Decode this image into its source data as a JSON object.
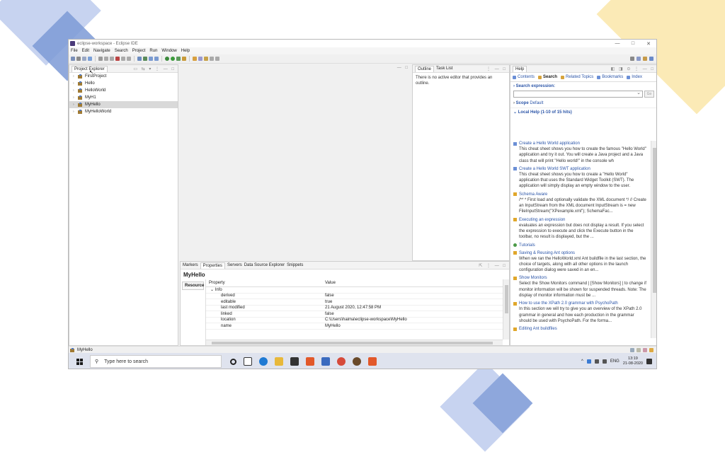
{
  "window": {
    "title": "eclipse-workspace - Eclipse IDE",
    "minimize": "—",
    "maximize": "□",
    "close": "✕"
  },
  "menu": [
    "File",
    "Edit",
    "Navigate",
    "Search",
    "Project",
    "Run",
    "Window",
    "Help"
  ],
  "explorer": {
    "tab": "Project Explorer",
    "projects": [
      {
        "name": "FirstProject",
        "selected": false
      },
      {
        "name": "Hello",
        "selected": false
      },
      {
        "name": "HelloWorld",
        "selected": false
      },
      {
        "name": "MyH1",
        "selected": false
      },
      {
        "name": "MyHello",
        "selected": true
      },
      {
        "name": "MyHelloWorld",
        "selected": false
      }
    ]
  },
  "outline": {
    "tabs": [
      "Outline",
      "Task List"
    ],
    "message": "There is no active editor that provides an outline."
  },
  "properties": {
    "tabs": [
      "Markers",
      "Properties",
      "Servers",
      "Data Source Explorer",
      "Snippets"
    ],
    "title": "MyHello",
    "side_tab": "Resource",
    "header": {
      "property": "Property",
      "value": "Value"
    },
    "group": "Info",
    "rows": [
      {
        "property": "derived",
        "value": "false"
      },
      {
        "property": "editable",
        "value": "true"
      },
      {
        "property": "last modified",
        "value": "21 August 2020, 12:47:58 PM"
      },
      {
        "property": "linked",
        "value": "false"
      },
      {
        "property": "location",
        "value": "C:\\Users\\haima\\eclipse-workspace\\MyHello"
      },
      {
        "property": "name",
        "value": "MyHello"
      }
    ]
  },
  "help": {
    "tab": "Help",
    "tabs": [
      "Contents",
      "Search",
      "Related Topics",
      "Bookmarks",
      "Index"
    ],
    "search_label": "Search expression:",
    "go": "Go",
    "scope_label": "Scope",
    "scope_value": "Default",
    "hits": "Local Help (1-10 of 15 hits)",
    "results": [
      {
        "title": "Create a Hello World application",
        "icon": "cheatsheet",
        "desc": "This cheat sheet shows you how to create the famous \"Hello World\" application and try it out. You will create a Java project and a Java class that will print \"Hello world!\" in the console wh"
      },
      {
        "title": "Create a Hello World SWT application",
        "icon": "cheatsheet",
        "desc": "This cheat sheet shows you how to create a \"Hello World\" application that uses the Standard Widget Toolkit (SWT). The application will simply display an empty window to the user."
      },
      {
        "title": "Schema Aware",
        "icon": "ant",
        "desc": "/** * First load and optionally validate the XML document */ // Create an InputStream from the XML document InputStream is = new FileInputStream(\"XPexample.xml\"); SchemaFac..."
      },
      {
        "title": "Executing an expression",
        "icon": "ant",
        "desc": "evaluates an expression but does not display a result. If you select the expression to execute and click the Execute button in the toolbar, no result is displayed, but the ..."
      },
      {
        "title": "Tutorials",
        "icon": "tutorial",
        "desc": ""
      },
      {
        "title": "Saving & Reusing Ant options",
        "icon": "ant",
        "desc": "When we ran the HelloWorld.xml Ant buildfile in the last section, the choice of targets, along with all other options in the launch configuration dialog were saved in an en..."
      },
      {
        "title": "Show Monitors",
        "icon": "ant",
        "desc": "Select the Show Monitors command | [Show Monitors] | to change if monitor information will be shown for suspended threads. Note: The display of monitor information must be ..."
      },
      {
        "title": "How to use the XPath 2.0 grammar with PsychoPath",
        "icon": "ant",
        "desc": "In this section we will try to give you an overview of the XPath 2.0 grammar in general and how each production in the grammar should be used with PsychoPath. For the forma..."
      },
      {
        "title": "Editing Ant buildfiles",
        "icon": "ant",
        "desc": ""
      }
    ]
  },
  "status": {
    "selected": "MyHello"
  },
  "taskbar": {
    "search_placeholder": "Type here to search",
    "lang": "ENG",
    "time": "13:19",
    "date": "21-08-2020"
  },
  "colors": {
    "accent": "#2b55a8",
    "selection": "#d9d9d9"
  }
}
